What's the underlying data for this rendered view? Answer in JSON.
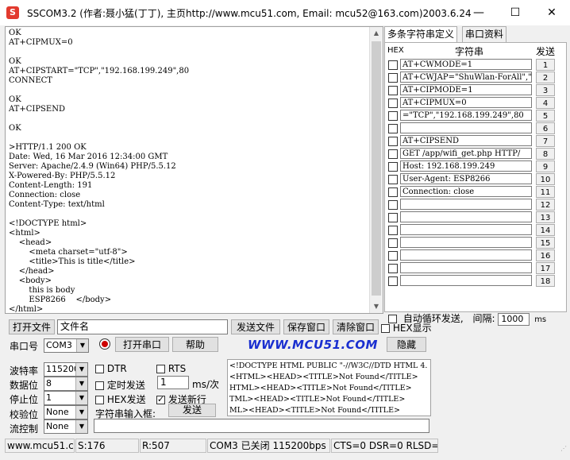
{
  "window": {
    "title": "SSCOM3.2 (作者:聂小猛(丁丁), 主页http://www.mcu51.com,  Email: mcu52@163.com)2003.6.24",
    "icon_glyph": "S",
    "minimize": "—",
    "maximize": "☐",
    "close": "✕"
  },
  "receive": {
    "text": "OK\nAT+CIPMUX=0\n\nOK\nAT+CIPSTART=\"TCP\",\"192.168.199.249\",80\nCONNECT\n\nOK\nAT+CIPSEND\n\nOK\n\n>HTTP/1.1 200 OK\nDate: Wed, 16 Mar 2016 12:34:00 GMT\nServer: Apache/2.4.9 (Win64) PHP/5.5.12\nX-Powered-By: PHP/5.5.12\nContent-Length: 191\nConnection: close\nContent-Type: text/html\n\n<!DOCTYPE html>\n<html>\n    <head>\n        <meta charset=\"utf-8\">\n        <title>This is title</title>\n    </head>\n    <body>\n        this is body\n        ESP8266    </body>\n</html>"
  },
  "multi": {
    "tabs": [
      "多条字符串定义",
      "串口资料"
    ],
    "header": {
      "hex": "HEX",
      "string": "字符串",
      "send": "发送"
    },
    "rows": [
      {
        "text": "AT+CWMODE=1",
        "num": "1"
      },
      {
        "text": "AT+CWJAP=\"ShuWlan-ForAll\",\"",
        "num": "2"
      },
      {
        "text": "AT+CIPMODE=1",
        "num": "3"
      },
      {
        "text": "AT+CIPMUX=0",
        "num": "4"
      },
      {
        "text": "=\"TCP\",\"192.168.199.249\",80",
        "num": "5"
      },
      {
        "text": "",
        "num": "6"
      },
      {
        "text": "AT+CIPSEND",
        "num": "7"
      },
      {
        "text": "GET /app/wifi_get.php HTTP/",
        "num": "8"
      },
      {
        "text": "Host: 192.168.199.249",
        "num": "9"
      },
      {
        "text": "User-Agent: ESP8266",
        "num": "10"
      },
      {
        "text": "Connection: close",
        "num": "11"
      },
      {
        "text": "",
        "num": "12"
      },
      {
        "text": "",
        "num": "13"
      },
      {
        "text": "",
        "num": "14"
      },
      {
        "text": "",
        "num": "15"
      },
      {
        "text": "",
        "num": "16"
      },
      {
        "text": "",
        "num": "17"
      },
      {
        "text": "",
        "num": "18"
      }
    ],
    "loop_label": "自动循环发送,",
    "interval_label": "间隔:",
    "interval_value": "1000",
    "interval_unit": "ms"
  },
  "controls": {
    "open_file": "打开文件",
    "filename": "文件名",
    "send_file": "发送文件",
    "save_window": "保存窗口",
    "clear_window": "清除窗口",
    "hex_display": "HEX显示",
    "port_label": "串口号",
    "port_value": "COM3",
    "open_port": "打开串口",
    "help": "帮助",
    "website": "WWW.MCU51.COM",
    "expand": "隐藏",
    "baud_label": "波特率",
    "baud_value": "115200",
    "databits_label": "数据位",
    "databits_value": "8",
    "stopbits_label": "停止位",
    "stopbits_value": "1",
    "parity_label": "校验位",
    "parity_value": "None",
    "flow_label": "流控制",
    "flow_value": "None",
    "dtr": "DTR",
    "rts": "RTS",
    "timed_send": "定时发送",
    "timed_value": "1",
    "timed_unit": "ms/次",
    "hex_send": "HEX发送",
    "send_newline": "发送新行",
    "input_label": "字符串输入框:",
    "send_button": "发送",
    "send_text": "<!DOCTYPE HTML PUBLIC \"-//W3C//DTD HTML 4.\n<HTML><HEAD><TITLE>Not Found</TITLE>\nHTML><HEAD><TITLE>Not Found</TITLE>\nTML><HEAD><TITLE>Not Found</TITLE>\nML><HEAD><TITLE>Not Found</TITLE>"
  },
  "status": {
    "site": "www.mcu51.cor",
    "sent": "S:176",
    "received": "R:507",
    "port_state": "COM3 已关闭  115200bps",
    "lines": "CTS=0 DSR=0 RLSD=0"
  },
  "colors": {
    "website": "#1a2fd0",
    "radio_on": "#cc0000"
  }
}
